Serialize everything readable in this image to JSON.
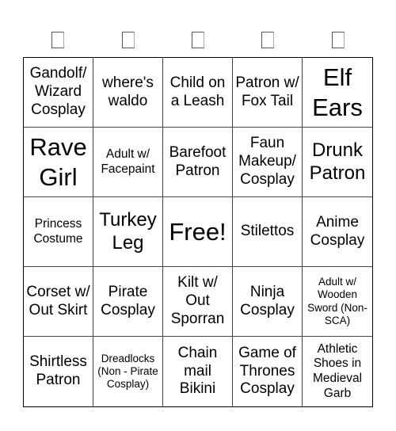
{
  "header": {
    "columns": [
      "□",
      "□",
      "□",
      "□",
      "□"
    ]
  },
  "card": {
    "cells": [
      {
        "text": "Gandolf/ Wizard Cosplay",
        "size": "s-md"
      },
      {
        "text": "where's waldo",
        "size": "s-md"
      },
      {
        "text": "Child on a Leash",
        "size": "s-md"
      },
      {
        "text": "Patron w/ Fox Tail",
        "size": "s-md"
      },
      {
        "text": "Elf Ears",
        "size": "s-xl"
      },
      {
        "text": "Rave Girl",
        "size": "s-xl"
      },
      {
        "text": "Adult w/ Facepaint",
        "size": "s-sm"
      },
      {
        "text": "Barefoot Patron",
        "size": "s-md"
      },
      {
        "text": "Faun Makeup/ Cosplay",
        "size": "s-md"
      },
      {
        "text": "Drunk Patron",
        "size": "s-lg"
      },
      {
        "text": "Princess Costume",
        "size": "s-sm"
      },
      {
        "text": "Turkey Leg",
        "size": "s-lg"
      },
      {
        "text": "Free!",
        "size": "s-xl"
      },
      {
        "text": "Stilettos",
        "size": "s-md"
      },
      {
        "text": "Anime Cosplay",
        "size": "s-md"
      },
      {
        "text": "Corset w/ Out Skirt",
        "size": "s-md"
      },
      {
        "text": "Pirate Cosplay",
        "size": "s-md"
      },
      {
        "text": "Kilt w/ Out Sporran",
        "size": "s-md"
      },
      {
        "text": "Ninja Cosplay",
        "size": "s-md"
      },
      {
        "text": "Adult w/ Wooden Sword (Non-SCA)",
        "size": "s-xs"
      },
      {
        "text": "Shirtless Patron",
        "size": "s-md"
      },
      {
        "text": "Dreadlocks (Non - Pirate Cosplay)",
        "size": "s-xs"
      },
      {
        "text": "Chain mail Bikini",
        "size": "s-md"
      },
      {
        "text": "Game of Thrones Cosplay",
        "size": "s-md"
      },
      {
        "text": "Athletic Shoes in Medieval Garb",
        "size": "s-sm"
      }
    ]
  }
}
